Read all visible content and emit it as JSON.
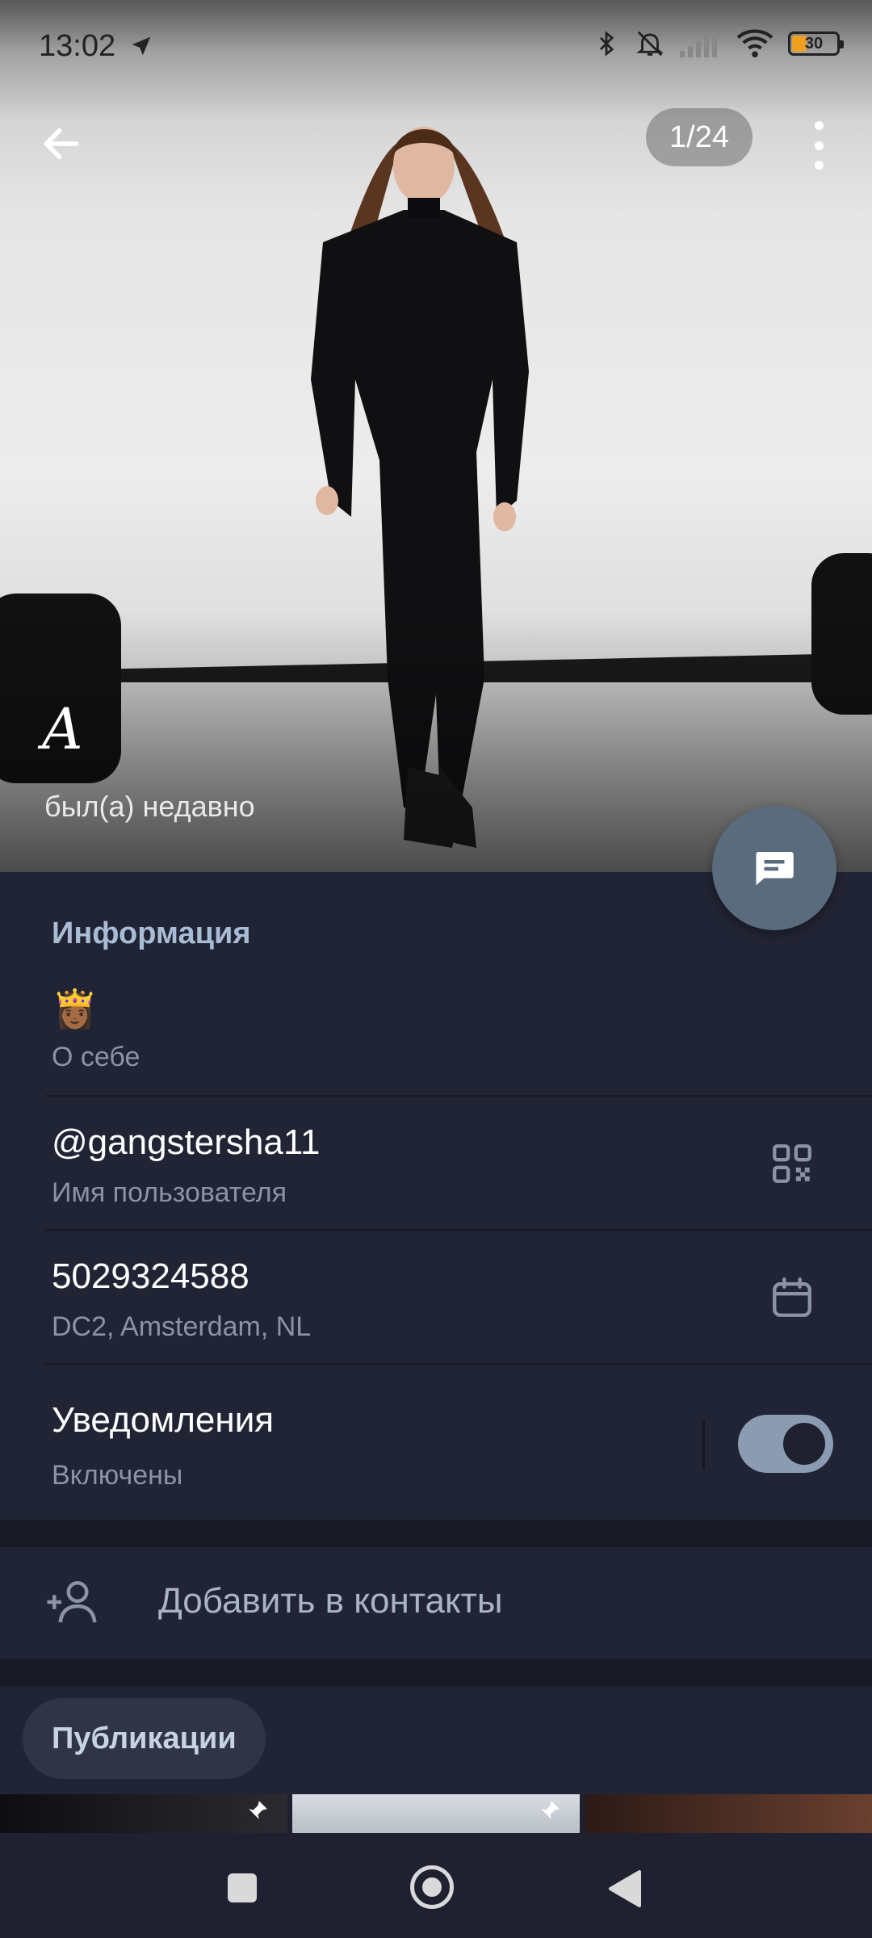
{
  "status_bar": {
    "time": "13:02",
    "battery_level": "30",
    "icons": [
      "location-arrow-icon",
      "bluetooth-icon",
      "bell-off-icon",
      "signal-icon",
      "wifi-icon",
      "battery-icon"
    ]
  },
  "header": {
    "photo_counter": "1/24",
    "back_icon": "arrow-left-icon",
    "menu_icon": "more-vertical-icon"
  },
  "profile": {
    "name": "A",
    "last_seen": "был(а) недавно"
  },
  "info": {
    "section_title": "Информация",
    "bio": {
      "value": "👸🏾",
      "label": "О себе"
    },
    "username": {
      "value": "@gangstersha11",
      "label": "Имя пользователя",
      "icon": "qr-code-icon"
    },
    "id": {
      "value": "5029324588",
      "label": "DC2, Amsterdam, NL",
      "icon": "calendar-icon"
    },
    "notifications": {
      "value": "Уведомления",
      "label": "Включены",
      "enabled": true
    }
  },
  "actions": {
    "add_contact": "Добавить в контакты"
  },
  "tabs": {
    "publications": "Публикации"
  },
  "colors": {
    "background": "#1f2130",
    "section": "#212434",
    "accent": "#a9bcd6",
    "fab": "#5b6b7e"
  }
}
